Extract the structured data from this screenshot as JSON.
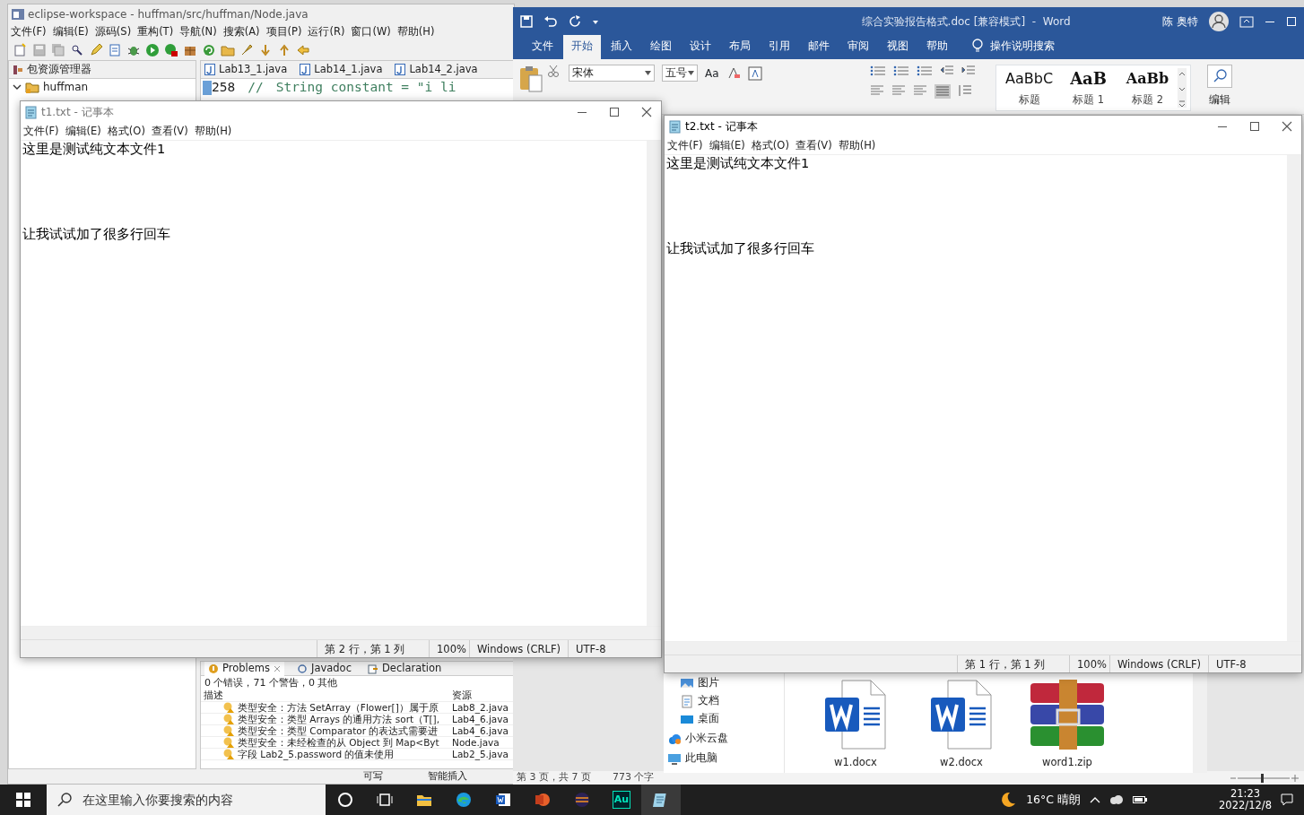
{
  "eclipse": {
    "title": "eclipse-workspace - huffman/src/huffman/Node.java",
    "menu": [
      "文件(F)",
      "编辑(E)",
      "源码(S)",
      "重构(T)",
      "导航(N)",
      "搜索(A)",
      "项目(P)",
      "运行(R)",
      "窗口(W)",
      "帮助(H)"
    ],
    "explorer_tab": "包资源管理器",
    "tree": [
      {
        "label": "huffman",
        "expanded": true
      }
    ],
    "editor_tabs": [
      "Lab13_1.java",
      "Lab14_1.java",
      "Lab14_2.java"
    ],
    "code": {
      "line_number": "258",
      "comment": "//",
      "text": "String constant = \"i li"
    },
    "problems": {
      "tabs": [
        {
          "label": "Problems",
          "selected": true
        },
        {
          "label": "Javadoc",
          "selected": false
        },
        {
          "label": "Declaration",
          "selected": false
        }
      ],
      "summary": "0 个错误，71 个警告，0 其他",
      "columns": [
        "描述",
        "资源"
      ],
      "rows": [
        {
          "description": "类型安全：方法 SetArray（Flower[]）属于原",
          "resource": "Lab8_2.java"
        },
        {
          "description": "类型安全：类型 Arrays 的通用方法 sort（T[],",
          "resource": "Lab4_6.java"
        },
        {
          "description": "类型安全：类型 Comparator 的表达式需要进",
          "resource": "Lab4_6.java"
        },
        {
          "description": "类型安全：未经检查的从 Object 到 Map<Byt",
          "resource": "Node.java"
        },
        {
          "description": "字段 Lab2_5.password 的值未使用",
          "resource": "Lab2_5.java"
        }
      ]
    },
    "status": [
      "可写",
      "智能插入"
    ]
  },
  "word": {
    "title": "综合实验报告格式.doc [兼容模式]  -  Word",
    "user": "陈 奥特",
    "tabs": [
      {
        "label": "文件",
        "selected": false
      },
      {
        "label": "开始",
        "selected": true
      },
      {
        "label": "插入",
        "selected": false
      },
      {
        "label": "绘图",
        "selected": false
      },
      {
        "label": "设计",
        "selected": false
      },
      {
        "label": "布局",
        "selected": false
      },
      {
        "label": "引用",
        "selected": false
      },
      {
        "label": "邮件",
        "selected": false
      },
      {
        "label": "审阅",
        "selected": false
      },
      {
        "label": "视图",
        "selected": false
      },
      {
        "label": "帮助",
        "selected": false
      }
    ],
    "tell_me": "操作说明搜索",
    "font": "宋体",
    "size": "五号",
    "case_button": "Aa",
    "styles": [
      {
        "preview": "AaBbC",
        "name": "标题",
        "kind": "title"
      },
      {
        "preview": "AaB",
        "name": "标题 1",
        "kind": "heading1"
      },
      {
        "preview": "AaBb",
        "name": "标题 2",
        "kind": "heading2"
      }
    ],
    "editing": "编辑",
    "status": [
      "第 3 页，共 7 页",
      "773 个字"
    ]
  },
  "notepads": [
    {
      "title": "t1.txt - 记事本",
      "menu": [
        "文件(F)",
        "编辑(E)",
        "格式(O)",
        "查看(V)",
        "帮助(H)"
      ],
      "lines": [
        "这里是测试纯文本文件1",
        "让我试试加了很多行回车"
      ],
      "status": [
        "第 2 行，第 1 列",
        "100%",
        "Windows (CRLF)",
        "UTF-8"
      ]
    },
    {
      "title": "t2.txt - 记事本",
      "menu": [
        "文件(F)",
        "编辑(E)",
        "格式(O)",
        "查看(V)",
        "帮助(H)"
      ],
      "lines": [
        "这里是测试纯文本文件1",
        "让我试试加了很多行回车"
      ],
      "status": [
        "第 1 行，第 1 列",
        "100%",
        "Windows (CRLF)",
        "UTF-8"
      ]
    }
  ],
  "file_explorer": {
    "nav": [
      {
        "label": "图片",
        "kind": "pictures"
      },
      {
        "label": "文档",
        "kind": "documents"
      },
      {
        "label": "桌面",
        "kind": "desktop"
      },
      {
        "label": "小米云盘",
        "kind": "cloud"
      },
      {
        "label": "此电脑",
        "kind": "pc"
      }
    ],
    "files": [
      {
        "name": "w1.docx",
        "kind": "word"
      },
      {
        "name": "w2.docx",
        "kind": "word"
      },
      {
        "name": "word1.zip",
        "kind": "archive"
      }
    ]
  },
  "taskbar": {
    "search_placeholder": "在这里输入你要搜索的内容",
    "app_label": "Au",
    "weather": "16°C 晴朗",
    "time": "21:23",
    "date": "2022/12/8"
  }
}
